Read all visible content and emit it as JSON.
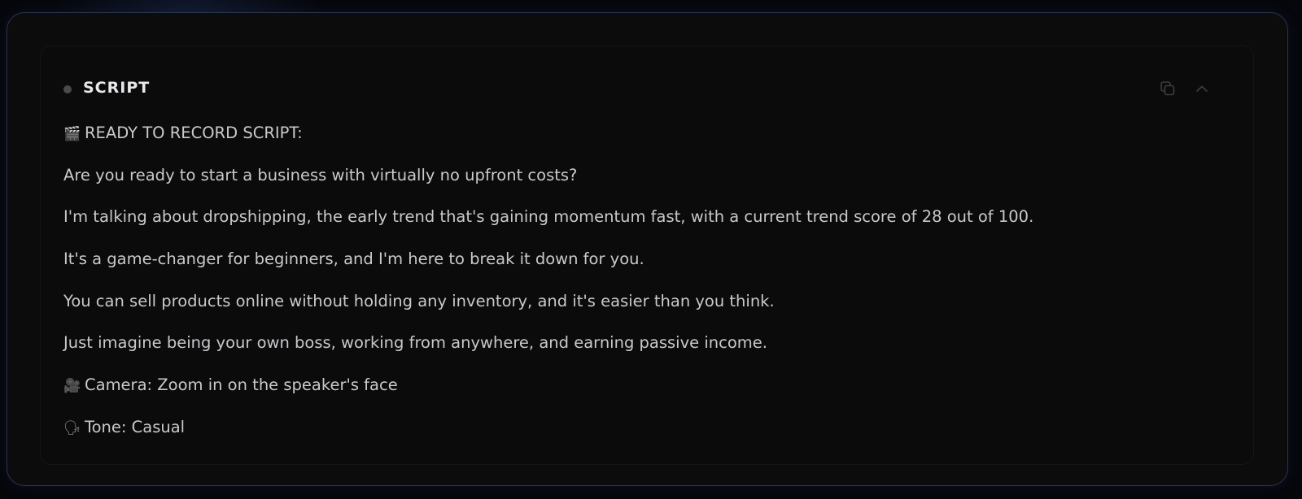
{
  "panel": {
    "title": "SCRIPT",
    "copy_icon": "copy-icon",
    "collapse_icon": "chevron-up-icon"
  },
  "script": {
    "lines": [
      {
        "emoji": "🎬",
        "text": "READY TO RECORD SCRIPT:"
      },
      {
        "emoji": "",
        "text": "Are you ready to start a business with virtually no upfront costs?"
      },
      {
        "emoji": "",
        "text": "I'm talking about dropshipping, the early trend that's gaining momentum fast, with a current trend score of 28 out of 100."
      },
      {
        "emoji": "",
        "text": "It's a game-changer for beginners, and I'm here to break it down for you."
      },
      {
        "emoji": "",
        "text": "You can sell products online without holding any inventory, and it's easier than you think."
      },
      {
        "emoji": "",
        "text": "Just imagine being your own boss, working from anywhere, and earning passive income."
      },
      {
        "emoji": "🎥",
        "text": "Camera: Zoom in on the speaker's face"
      },
      {
        "emoji": "🗣",
        "text": "Tone: Casual"
      }
    ]
  },
  "colors": {
    "background": "#05070b",
    "card": "#0c0c0d",
    "card_border": "#2a3450",
    "text": "#c9c9cc",
    "title": "#e8e8ea"
  }
}
